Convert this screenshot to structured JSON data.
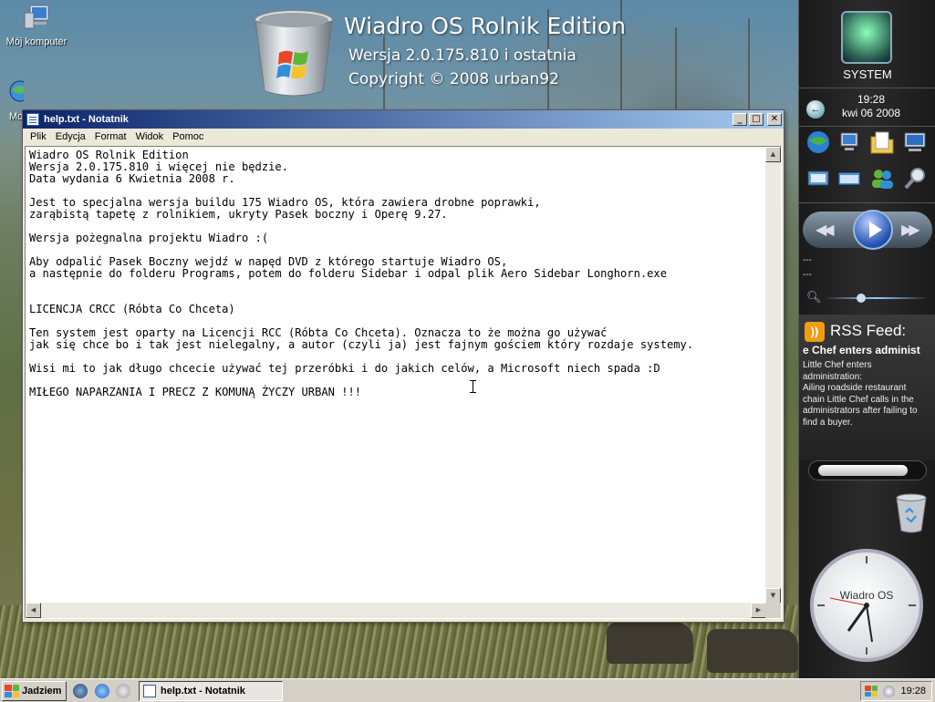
{
  "desktop": {
    "icons": [
      {
        "label": "Mój komputer",
        "icon": "computer-icon"
      },
      {
        "label": "Mo",
        "icon": "network-icon"
      }
    ],
    "brand": {
      "title": "Wiadro OS Rolnik Edition",
      "version": "Wersja 2.0.175.810 i ostatnia",
      "copyright": "Copyright © 2008 urban92"
    }
  },
  "notepad": {
    "title": "help.txt - Notatnik",
    "menu": [
      "Plik",
      "Edycja",
      "Format",
      "Widok",
      "Pomoc"
    ],
    "buttons": {
      "minimize": "_",
      "maximize": "□",
      "close": "✕"
    },
    "content": "Wiadro OS Rolnik Edition\nWersja 2.0.175.810 i więcej nie będzie.\nData wydania 6 Kwietnia 2008 r.\n\nJest to specjalna wersja buildu 175 Wiadro OS, która zawiera drobne poprawki,\nzarąbistą tapetę z rolnikiem, ukryty Pasek boczny i Operę 9.27.\n\nWersja pożegnalna projektu Wiadro :(\n\nAby odpalić Pasek Boczny wejdź w napęd DVD z którego startuje Wiadro OS,\na następnie do folderu Programs, potem do folderu Sidebar i odpal plik Aero Sidebar Longhorn.exe\n\n\nLICENCJA CRCC (Róbta Co Chceta)\n\nTen system jest oparty na Licencji RCC (Róbta Co Chceta). Oznacza to że można go używać\njak się chce bo i tak jest nielegalny, a autor (czyli ja) jest fajnym gościem który rozdaje systemy.\n\nWisi mi to jak długo chcecie używać tej przeróbki i do jakich celów, a Microsoft niech spada :D\n\nMIŁEGO NAPARZANIA I PRECZ Z KOMUNĄ ŻYCZY URBAN !!!"
  },
  "sidebar": {
    "system_label": "SYSTEM",
    "clock": {
      "time": "19:28",
      "date": "kwi 06 2008"
    },
    "media": {
      "line1": "---",
      "line2": "---"
    },
    "rss": {
      "title": "RSS Feed:",
      "headline": "e Chef enters administ",
      "body": "Little Chef enters\nadministration:\nAiling roadside restaurant\nchain Little Chef calls in the\nadministrators after failing to\nfind a buyer."
    },
    "analog_clock": {
      "brand": "Wiadro OS"
    }
  },
  "taskbar": {
    "start_label": "Jadziem",
    "tasks": [
      {
        "label": "help.txt - Notatnik",
        "active": true
      }
    ],
    "tray_time": "19:28"
  },
  "colors": {
    "titlebar_start": "#0a246a",
    "titlebar_end": "#a6caf0",
    "rss_orange": "#f39c12",
    "windows_red": "#e8462a",
    "windows_green": "#5fb536",
    "windows_blue": "#2f8fd8",
    "windows_yellow": "#f7c226"
  }
}
